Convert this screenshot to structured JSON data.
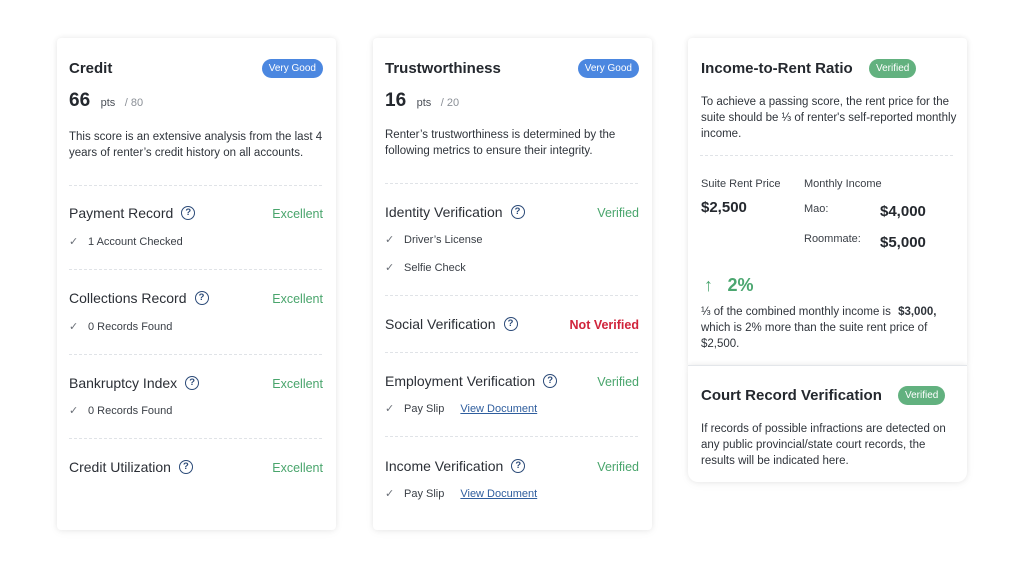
{
  "credit": {
    "title": "Credit",
    "badge": "Very Good",
    "score": "66",
    "unit": "pts",
    "max": "/ 80",
    "description": "This score is an extensive analysis from the last 4 years of renter’s credit history on all accounts.",
    "sections": [
      {
        "title": "Payment Record",
        "status": "Excellent",
        "items": [
          "1 Account Checked"
        ]
      },
      {
        "title": "Collections Record",
        "status": "Excellent",
        "items": [
          "0 Records Found"
        ]
      },
      {
        "title": "Bankruptcy Index",
        "status": "Excellent",
        "items": [
          "0 Records Found"
        ]
      },
      {
        "title": "Credit Utilization",
        "status": "Excellent",
        "items": []
      }
    ]
  },
  "trust": {
    "title": "Trustworthiness",
    "badge": "Very Good",
    "score": "16",
    "unit": "pts",
    "max": "/ 20",
    "description": "Renter’s trustworthiness is determined by the following metrics to ensure their integrity.",
    "sections": [
      {
        "title": "Identity Verification",
        "status": "Verified",
        "items": [
          "Driver’s License",
          "Selfie Check"
        ]
      },
      {
        "title": "Social Verification",
        "status": "Not Verified",
        "items": []
      },
      {
        "title": "Employment Verification",
        "status": "Verified",
        "items": [
          "Pay Slip"
        ],
        "link": "View Document"
      },
      {
        "title": "Income Verification",
        "status": "Verified",
        "items": [
          "Pay Slip"
        ],
        "link": "View Document"
      }
    ]
  },
  "income": {
    "title": "Income-to-Rent Ratio",
    "badge": "Verified",
    "description": "To achieve a passing score, the rent price for the suite should be ⅓ of renter's self-reported monthly income.",
    "rent_label": "Suite Rent Price",
    "rent_value": "$2,500",
    "monthly_label": "Monthly Income",
    "earners": [
      {
        "name": "Mao:",
        "amount": "$4,000"
      },
      {
        "name": "Roommate:",
        "amount": "$5,000"
      }
    ],
    "percent": "2%",
    "summary_prefix": "⅓ of the combined monthly income is",
    "summary_amount": "$3,000,",
    "summary_rest": "which is 2% more than the suite rent price of $2,500."
  },
  "court": {
    "title": "Court Record Verification",
    "badge": "Verified",
    "description": "If records of possible infractions are detected on any public provincial/state court records, the results will be indicated here."
  },
  "colors": {
    "badge_blue": "#4b87e0",
    "badge_green": "#62b17f",
    "status_good": "#49a56c",
    "status_bad": "#d0243b",
    "link": "#2f5e9e"
  },
  "icons": {
    "help": "question-circle-icon",
    "check": "check-icon",
    "trend": "arrow-up-icon"
  }
}
